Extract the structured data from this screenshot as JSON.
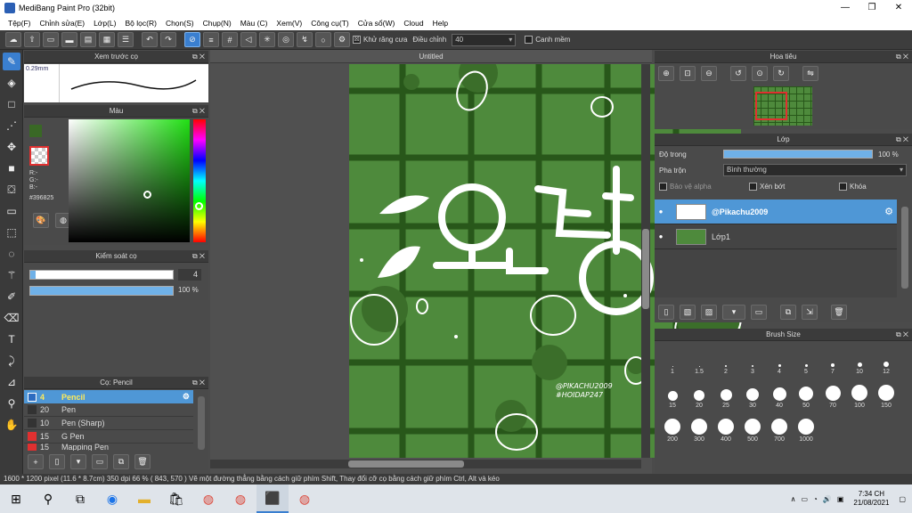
{
  "window": {
    "title": "MediBang Paint Pro (32bit)",
    "min": "—",
    "max": "❐",
    "close": "✕"
  },
  "menu": [
    "Tệp(F)",
    "Chỉnh sửa(E)",
    "Lớp(L)",
    "Bộ lọc(R)",
    "Chọn(S)",
    "Chụp(N)",
    "Màu (C)",
    "Xem(V)",
    "Công cụ(T)",
    "Cửa sổ(W)",
    "Cloud",
    "Help"
  ],
  "toolbar": {
    "antialias": "Khử răng cưa",
    "antialias_checked": "☒",
    "adjust_label": "Điều chỉnh",
    "adjust_value": "40",
    "edge_label": "Canh mềm"
  },
  "preview_panel": {
    "title": "Xem trước cọ",
    "size": "0.29mm"
  },
  "color_panel": {
    "title": "Màu",
    "r": "R:-",
    "g": "G:-",
    "b": "B:-",
    "hex": "#396825",
    "fg": "#396825"
  },
  "brush_control": {
    "title": "Kiểm soát cọ",
    "size": "4",
    "opacity": "100 %"
  },
  "brush_panel": {
    "title": "Cọ: Pencil",
    "items": [
      {
        "size": "4",
        "name": "Pencil",
        "color": "#2d6cc0"
      },
      {
        "size": "20",
        "name": "Pen",
        "color": "#333333"
      },
      {
        "size": "10",
        "name": "Pen (Sharp)",
        "color": "#333333"
      },
      {
        "size": "15",
        "name": "G Pen",
        "color": "#e03030"
      },
      {
        "size": "15",
        "name": "Mapping Pen",
        "color": "#e03030"
      }
    ]
  },
  "document": {
    "title": "Untitled",
    "text": "안녕",
    "credit1": "@PIKACHU2009",
    "credit2": "#HOIDAP247"
  },
  "navigator": {
    "title": "Hoa tiêu"
  },
  "layers_panel": {
    "title": "Lớp",
    "opacity_label": "Độ trong",
    "opacity_value": "100 %",
    "blend_label": "Pha trộn",
    "blend_value": "Bình thường",
    "protect_alpha": "Bảo vệ alpha",
    "clipping": "Xén bớt",
    "lock": "Khóa",
    "layers": [
      {
        "name": "@Pikachu2009",
        "selected": true
      },
      {
        "name": "Lớp1",
        "selected": false
      }
    ]
  },
  "brush_size": {
    "title": "Brush Size",
    "sizes": [
      "1",
      "1.5",
      "2",
      "3",
      "4",
      "5",
      "7",
      "10",
      "12",
      "15",
      "20",
      "25",
      "30",
      "40",
      "50",
      "70",
      "100",
      "150",
      "200",
      "300",
      "400",
      "500",
      "700",
      "1000"
    ]
  },
  "status": "1600 * 1200 pixel   (11.6 * 8.7cm)   350 dpi   66 %   ( 843, 570 )   Vẽ một đường thẳng bằng cách giữ phím Shift, Thay đổi cỡ cọ bằng cách giữ phím Ctrl, Alt và kéo",
  "taskbar": {
    "time": "7:34 CH",
    "date": "21/08/2021"
  }
}
